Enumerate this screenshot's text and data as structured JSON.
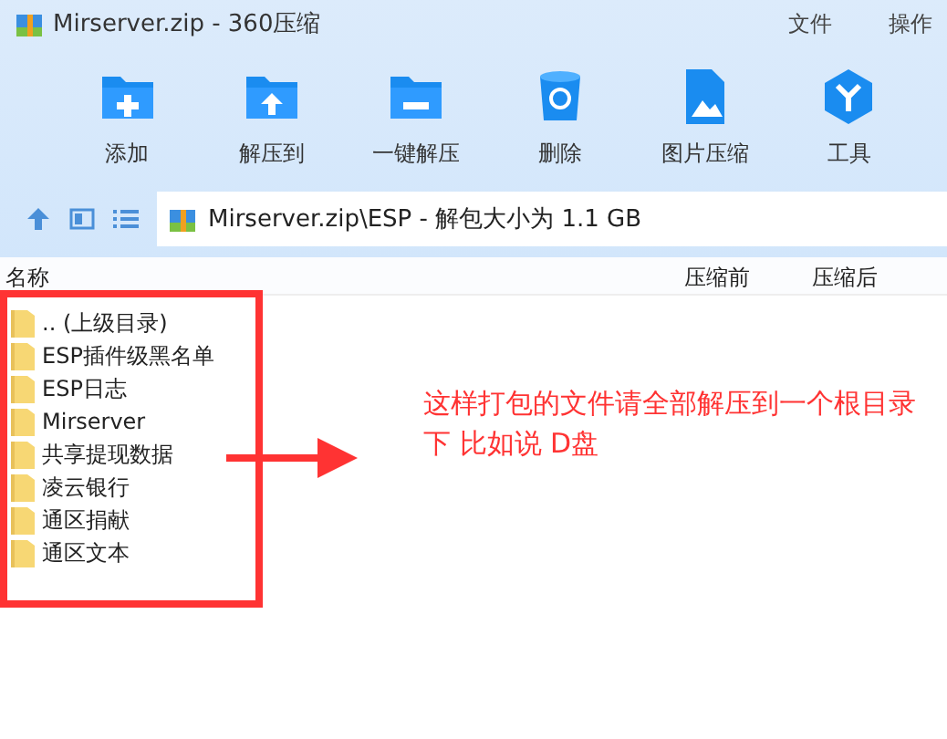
{
  "window": {
    "title": "Mirserver.zip - 360压缩",
    "menu": [
      "文件",
      "操作"
    ]
  },
  "toolbar": [
    {
      "label": "添加",
      "kind": "add"
    },
    {
      "label": "解压到",
      "kind": "extract"
    },
    {
      "label": "一键解压",
      "kind": "oneclick"
    },
    {
      "label": "删除",
      "kind": "delete"
    },
    {
      "label": "图片压缩",
      "kind": "image"
    },
    {
      "label": "工具",
      "kind": "tools"
    }
  ],
  "address": {
    "path": "Mirserver.zip\\ESP - 解包大小为 1.1 GB"
  },
  "table": {
    "columns": [
      "名称",
      "压缩前",
      "压缩后"
    ],
    "rows": [
      {
        "name": ".. (上级目录)"
      },
      {
        "name": "ESP插件级黑名单"
      },
      {
        "name": "ESP日志"
      },
      {
        "name": "Mirserver"
      },
      {
        "name": "共享提现数据"
      },
      {
        "name": "凌云银行"
      },
      {
        "name": "通区捐献"
      },
      {
        "name": "通区文本"
      }
    ]
  },
  "annotation": {
    "text": "这样打包的文件请全部解压到一个根目录下 比如说 D盘"
  }
}
